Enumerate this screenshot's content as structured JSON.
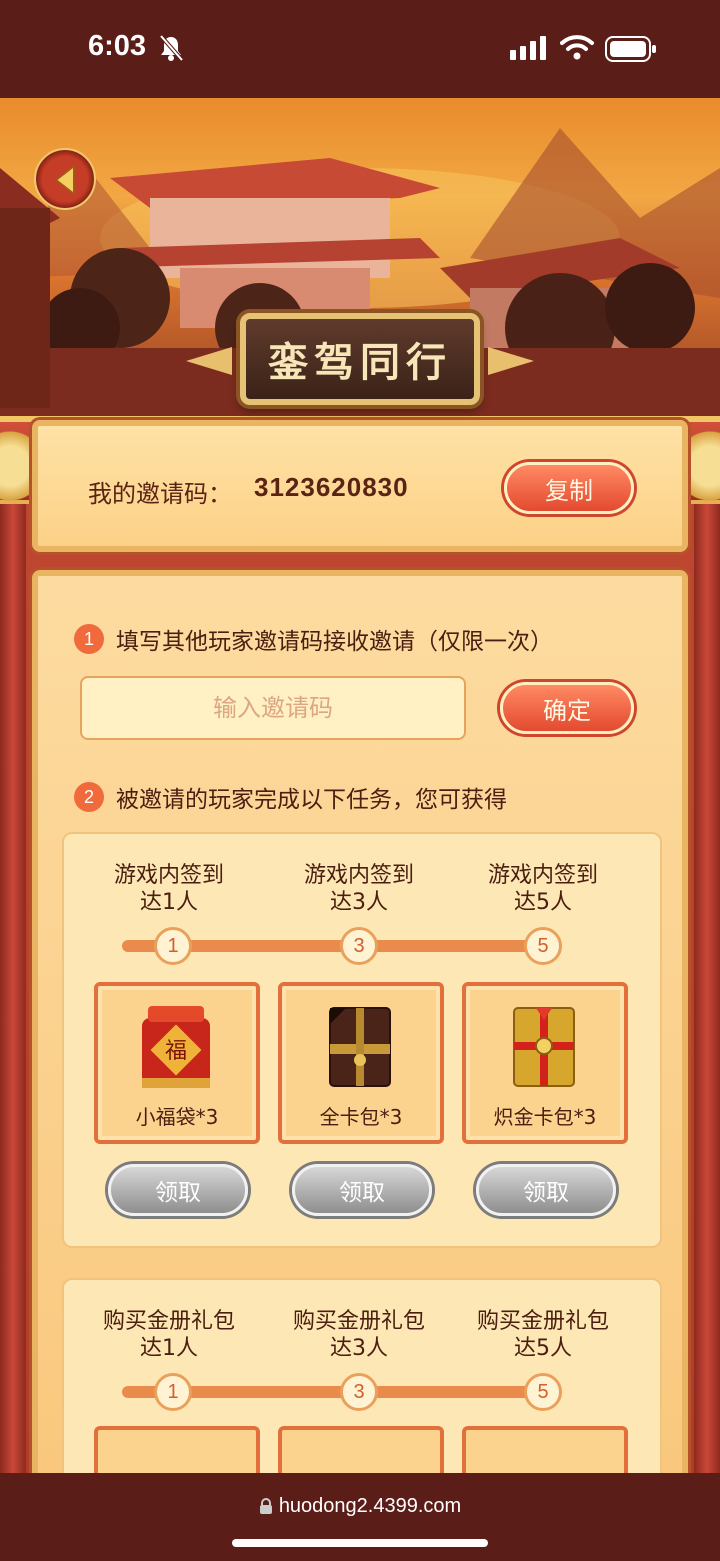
{
  "status_bar": {
    "time": "6:03"
  },
  "header": {
    "title": "銮驾同行"
  },
  "invite": {
    "label": "我的邀请码：",
    "code": "3123620830",
    "copy_label": "复制"
  },
  "step1": {
    "number": "1",
    "text": "填写其他玩家邀请码接收邀请（仅限一次）",
    "input_placeholder": "输入邀请码",
    "confirm_label": "确定"
  },
  "step2": {
    "number": "2",
    "text": "被邀请的玩家完成以下任务，您可获得"
  },
  "signin_panel": {
    "milestones": [
      {
        "line1": "游戏内签到",
        "line2": "达1人",
        "node": "1"
      },
      {
        "line1": "游戏内签到",
        "line2": "达3人",
        "node": "3"
      },
      {
        "line1": "游戏内签到",
        "line2": "达5人",
        "node": "5"
      }
    ],
    "rewards": [
      {
        "name": "小福袋*3",
        "icon": "lucky-bag-icon"
      },
      {
        "name": "全卡包*3",
        "icon": "card-pack-icon"
      },
      {
        "name": "炽金卡包*3",
        "icon": "gold-card-pack-icon"
      }
    ],
    "claim_label": "领取"
  },
  "purchase_panel": {
    "milestones": [
      {
        "line1": "购买金册礼包",
        "line2": "达1人",
        "node": "1"
      },
      {
        "line1": "购买金册礼包",
        "line2": "达3人",
        "node": "3"
      },
      {
        "line1": "购买金册礼包",
        "line2": "达5人",
        "node": "5"
      }
    ]
  },
  "browser": {
    "url": "huodong2.4399.com"
  },
  "colors": {
    "accent_red": "#e34a2f",
    "card_bg": "#fddba0",
    "claim_disabled": "#8e8e8e"
  }
}
